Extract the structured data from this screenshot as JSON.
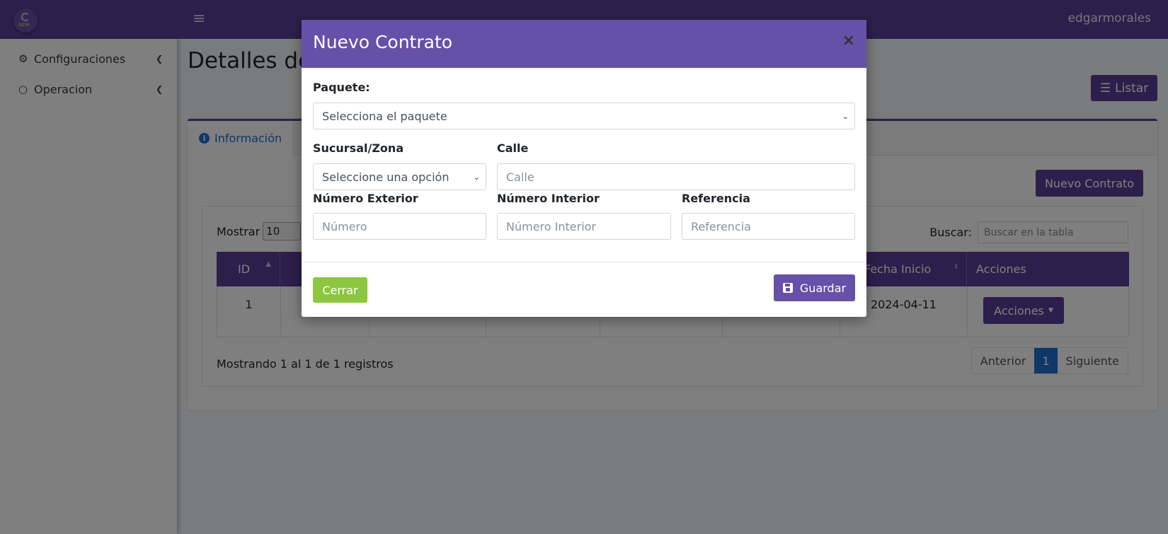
{
  "navbar": {
    "hamburger_icon": "≡",
    "user": "edgarmorales"
  },
  "sidebar": {
    "items": [
      {
        "label": "Configuraciones",
        "icon": "gear-icon"
      },
      {
        "label": "Operacion",
        "icon": "circle-icon"
      }
    ]
  },
  "page": {
    "title": "Detalles de",
    "listar_label": "Listar",
    "tabs": [
      {
        "label": "Información",
        "icon": "info-icon"
      }
    ],
    "new_contract_label": "Nuevo Contrato"
  },
  "table": {
    "length_label": "Mostrar",
    "length_value": "10",
    "search_label": "Buscar:",
    "search_placeholder": "Buscar en la tabla",
    "headers": {
      "id": "ID",
      "fecha_inicio": "Fecha Inicio",
      "acciones": "Acciones"
    },
    "rows": [
      {
        "id": "1",
        "fecha_inicio": "2024-04-11",
        "acciones_label": "Acciones"
      }
    ],
    "info": "Mostrando 1 al 1 de 1 registros",
    "pagination": {
      "prev": "Anterior",
      "current": "1",
      "next": "Siguiente"
    }
  },
  "modal": {
    "title": "Nuevo Contrato",
    "close_symbol": "×",
    "paquete": {
      "label": "Paquete:",
      "value": "Selecciona el paquete"
    },
    "sucursal": {
      "label": "Sucursal/Zona",
      "value": "Seleccione una opción"
    },
    "calle": {
      "label": "Calle",
      "placeholder": "Calle"
    },
    "numero_exterior": {
      "label": "Número Exterior",
      "placeholder": "Número"
    },
    "numero_interior": {
      "label": "Número Interior",
      "placeholder": "Número Interior"
    },
    "referencia": {
      "label": "Referencia",
      "placeholder": "Referencia"
    },
    "cerrar_label": "Cerrar",
    "guardar_label": "Guardar"
  },
  "colors": {
    "primary": "#5b3f96",
    "modal_header": "#6750a7",
    "success": "#8dc63f",
    "link": "#1f6fd1"
  }
}
